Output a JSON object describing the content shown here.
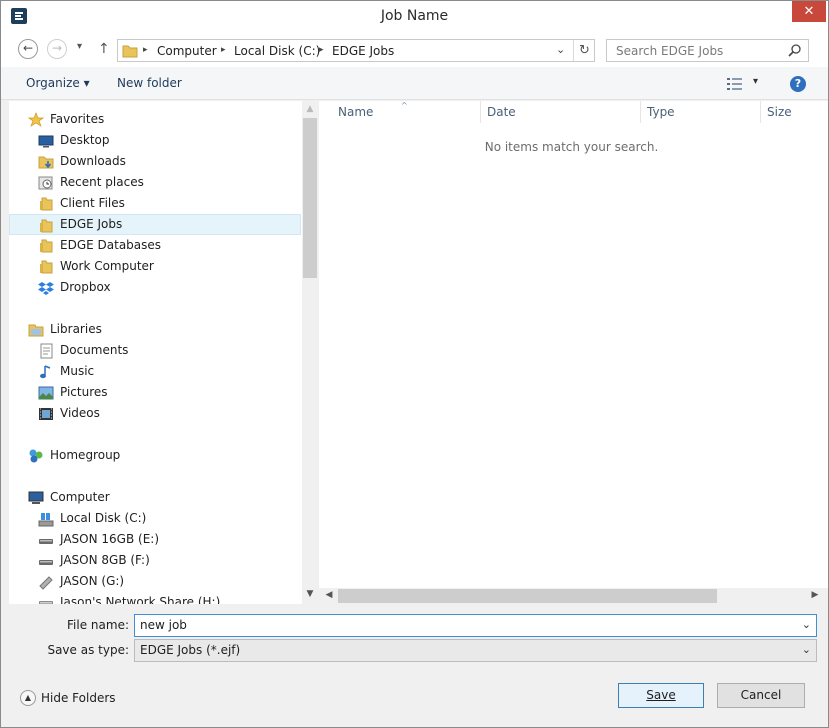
{
  "window": {
    "title": "Job Name",
    "close_glyph": "✕"
  },
  "nav": {
    "back_glyph": "←",
    "forward_glyph": "→",
    "recent_glyph": "▾",
    "up_glyph": "↑",
    "breadcrumbs": [
      "Computer",
      "Local Disk (C:)",
      "EDGE Jobs"
    ],
    "separator_glyph": "▸",
    "dropdown_glyph": "⌄",
    "refresh_glyph": "↻",
    "search_placeholder": "Search EDGE Jobs"
  },
  "toolbar": {
    "organize_label": "Organize ▾",
    "new_folder_label": "New folder",
    "view_drop_glyph": "▾",
    "help_glyph": "?"
  },
  "tree": {
    "items": [
      {
        "label": "Favorites",
        "icon": "star-icon"
      },
      {
        "label": "Desktop",
        "icon": "desktop-icon"
      },
      {
        "label": "Downloads",
        "icon": "downloads-icon"
      },
      {
        "label": "Recent places",
        "icon": "recent-places-icon"
      },
      {
        "label": "Client Files",
        "icon": "folder-icon"
      },
      {
        "label": "EDGE Jobs",
        "icon": "folder-icon",
        "selected": true
      },
      {
        "label": "EDGE Databases",
        "icon": "folder-icon"
      },
      {
        "label": "Work Computer",
        "icon": "folder-icon"
      },
      {
        "label": "Dropbox",
        "icon": "dropbox-icon"
      },
      {
        "label": "Libraries",
        "icon": "libraries-icon"
      },
      {
        "label": "Documents",
        "icon": "documents-icon"
      },
      {
        "label": "Music",
        "icon": "music-icon"
      },
      {
        "label": "Pictures",
        "icon": "pictures-icon"
      },
      {
        "label": "Videos",
        "icon": "videos-icon"
      },
      {
        "label": "Homegroup",
        "icon": "homegroup-icon"
      },
      {
        "label": "Computer",
        "icon": "computer-icon"
      },
      {
        "label": "Local Disk (C:)",
        "icon": "local-disk-icon"
      },
      {
        "label": "JASON 16GB (E:)",
        "icon": "usb-drive-icon"
      },
      {
        "label": "JASON 8GB (F:)",
        "icon": "usb-drive-icon"
      },
      {
        "label": "JASON (G:)",
        "icon": "removable-drive-icon"
      },
      {
        "label": "Jason's Network Share (H:)",
        "icon": "network-drive-icon"
      }
    ]
  },
  "scroll": {
    "up": "▲",
    "down": "▼",
    "left": "◀",
    "right": "▶"
  },
  "content": {
    "columns": [
      "Name",
      "Date",
      "Type",
      "Size"
    ],
    "sort_glyph": "^",
    "empty_message": "No items match your search."
  },
  "form": {
    "file_name_label": "File name:",
    "file_name_value": "new job",
    "save_type_label": "Save as type:",
    "save_type_value": "EDGE Jobs (*.ejf)",
    "dropdown_glyph": "⌄"
  },
  "footer": {
    "hide_folders_label": "Hide Folders",
    "hide_glyph": "▲",
    "save_label": "Save",
    "cancel_label": "Cancel"
  },
  "colors": {
    "close_red": "#c9483c",
    "selection": "#e5f3fb",
    "focus_blue": "#3f8fd2",
    "folder_yellow": "#e8c45a"
  }
}
